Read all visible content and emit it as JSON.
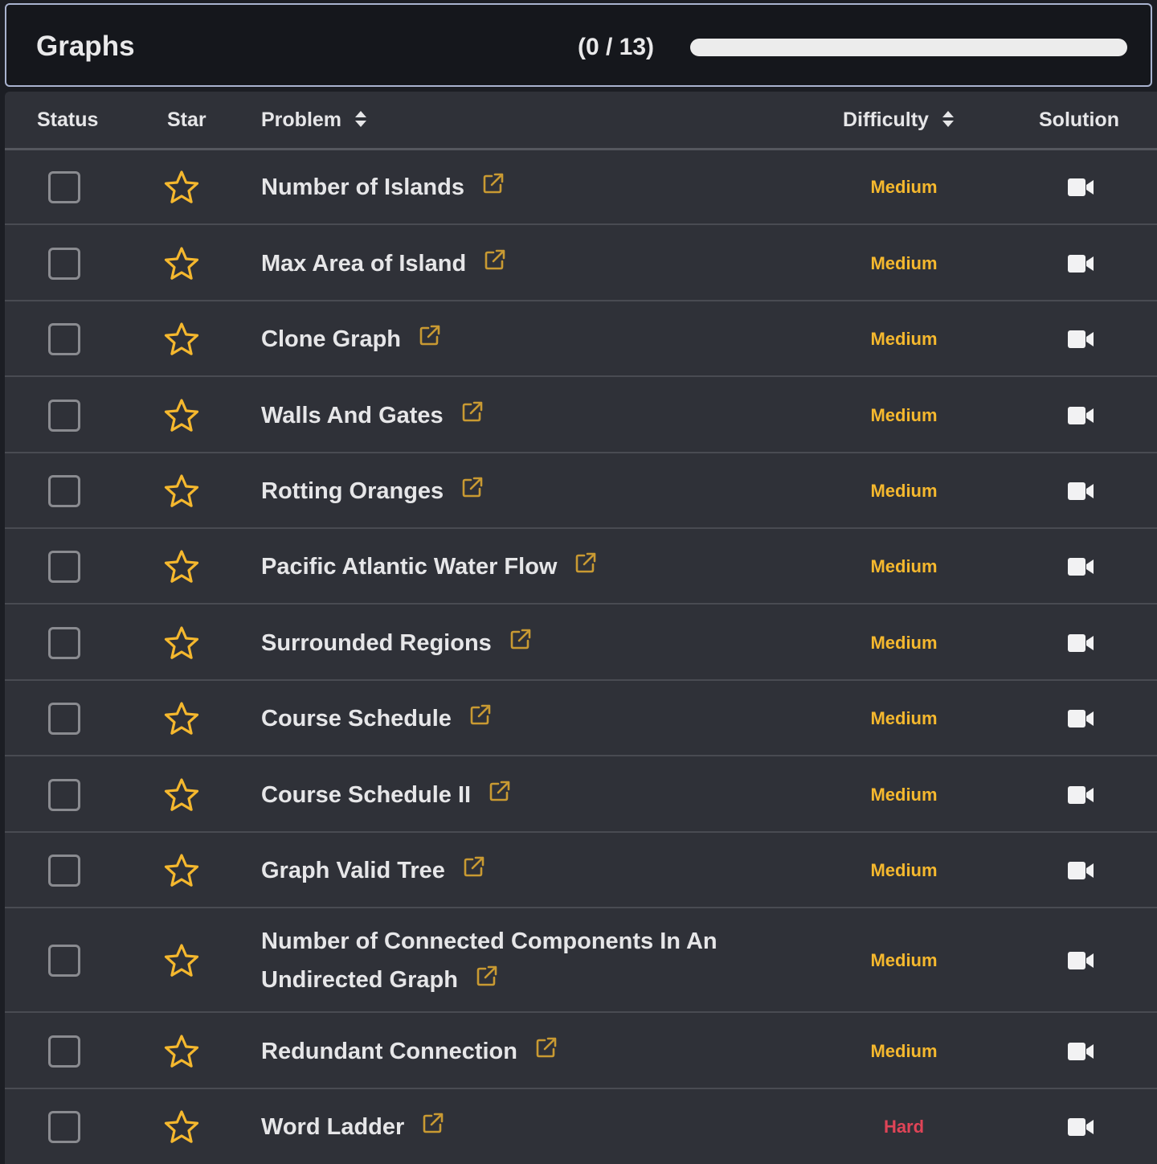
{
  "header": {
    "title": "Graphs",
    "progress_text": "(0 / 13)",
    "progress_fraction": 0
  },
  "columns": {
    "status": "Status",
    "star": "Star",
    "problem": "Problem",
    "difficulty": "Difficulty",
    "solution": "Solution"
  },
  "colors": {
    "medium": "#f5b82e",
    "hard": "#e04457",
    "star": "#f5b82e",
    "external_link": "#c99a32"
  },
  "icons": {
    "sort": "sort-icon",
    "star": "star-outline-icon",
    "external_link": "external-link-icon",
    "solution": "video-camera-icon"
  },
  "rows": [
    {
      "problem": "Number of Islands",
      "difficulty": "Medium"
    },
    {
      "problem": "Max Area of Island",
      "difficulty": "Medium"
    },
    {
      "problem": "Clone Graph",
      "difficulty": "Medium"
    },
    {
      "problem": "Walls And Gates",
      "difficulty": "Medium"
    },
    {
      "problem": "Rotting Oranges",
      "difficulty": "Medium"
    },
    {
      "problem": "Pacific Atlantic Water Flow",
      "difficulty": "Medium"
    },
    {
      "problem": "Surrounded Regions",
      "difficulty": "Medium"
    },
    {
      "problem": "Course Schedule",
      "difficulty": "Medium"
    },
    {
      "problem": "Course Schedule II",
      "difficulty": "Medium"
    },
    {
      "problem": "Graph Valid Tree",
      "difficulty": "Medium"
    },
    {
      "problem_line1": "Number of Connected Components In An",
      "problem_line2": "Undirected Graph",
      "difficulty": "Medium"
    },
    {
      "problem": "Redundant Connection",
      "difficulty": "Medium"
    },
    {
      "problem": "Word Ladder",
      "difficulty": "Hard"
    }
  ]
}
